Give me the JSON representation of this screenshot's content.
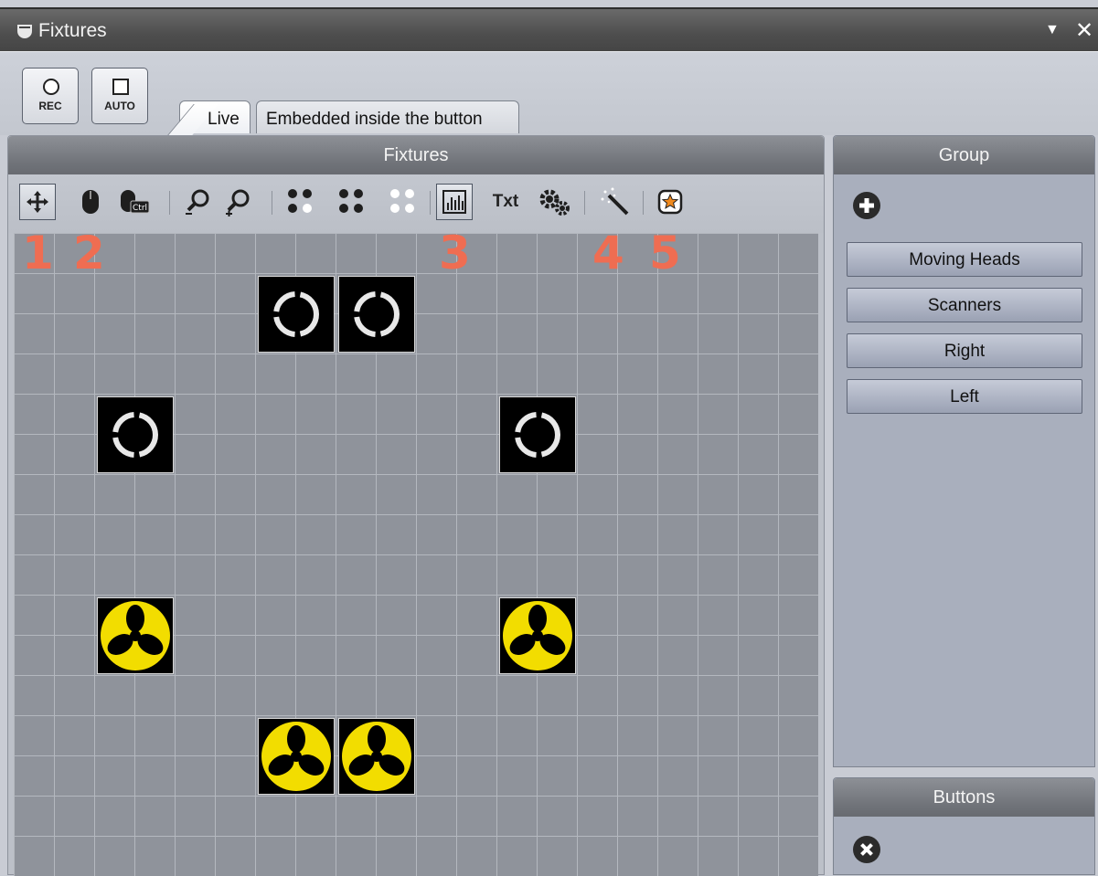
{
  "window": {
    "title": "Fixtures",
    "dropdown_icon": "triangle-down-icon",
    "close_icon": "close-icon"
  },
  "toolbar_top": {
    "rec_label": "REC",
    "auto_label": "AUTO"
  },
  "tabs": [
    {
      "label": "Live",
      "active": true
    },
    {
      "label": "Embedded inside the button",
      "active": false
    }
  ],
  "fixtures_panel": {
    "title": "Fixtures",
    "tools": [
      "move-icon",
      "mouse-icon",
      "mouse-ctrl-icon",
      "zoom-out-icon",
      "zoom-in-icon",
      "dots-icon-1",
      "dots-icon-2",
      "dots-icon-3",
      "channels-icon",
      "text-icon",
      "settings-icon",
      "magic-wand-icon",
      "star-icon"
    ],
    "text_tool_label": "Txt",
    "annotations": [
      "1",
      "2",
      "3",
      "4",
      "5"
    ]
  },
  "group_panel": {
    "title": "Group",
    "items": [
      "Moving Heads",
      "Scanners",
      "Right",
      "Left"
    ]
  },
  "buttons_panel": {
    "title": "Buttons"
  },
  "colors": {
    "annotation": "#ef6d52",
    "scanner_yellow": "#f2dd00"
  }
}
